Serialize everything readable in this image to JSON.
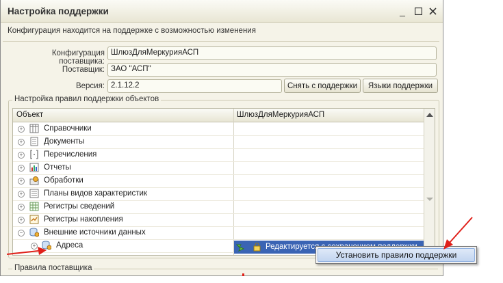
{
  "window": {
    "title": "Настройка поддержки",
    "subtitle": "Конфигурация находится на поддержке с возможностью изменения"
  },
  "form": {
    "vendor_config_label": "Конфигурация поставщика:",
    "vendor_config_value": "ШлюзДляМеркурияАСП",
    "vendor_label": "Поставщик:",
    "vendor_value": "ЗАО \"АСП\"",
    "version_label": "Версия:",
    "version_value": "2.1.12.2",
    "unsupport_button": "Снять с поддержки",
    "languages_button": "Языки поддержки"
  },
  "rules_group": {
    "label": "Настройка правил поддержки объектов",
    "columns": [
      "Объект",
      "ШлюзДляМеркурияАСП"
    ],
    "rows": [
      {
        "label": "Справочники",
        "icon": "catalog-icon",
        "expander": "+",
        "level": 0
      },
      {
        "label": "Документы",
        "icon": "document-icon",
        "expander": "+",
        "level": 0
      },
      {
        "label": "Перечисления",
        "icon": "enum-icon",
        "expander": "+",
        "level": 0
      },
      {
        "label": "Отчеты",
        "icon": "report-icon",
        "expander": "+",
        "level": 0
      },
      {
        "label": "Обработки",
        "icon": "processing-icon",
        "expander": "+",
        "level": 0
      },
      {
        "label": "Планы видов характеристик",
        "icon": "chart-types-icon",
        "expander": "+",
        "level": 0
      },
      {
        "label": "Регистры сведений",
        "icon": "info-register-icon",
        "expander": "+",
        "level": 0
      },
      {
        "label": "Регистры накопления",
        "icon": "accum-register-icon",
        "expander": "+",
        "level": 0
      },
      {
        "label": "Внешние источники данных",
        "icon": "external-sources-icon",
        "expander": "−",
        "level": 0
      },
      {
        "label": "Адреса",
        "icon": "external-source-item-icon",
        "expander": "+",
        "level": 1,
        "value": "Редактируется с сохранением поддержки"
      }
    ]
  },
  "context_menu": {
    "item": "Установить правило поддержки"
  },
  "vendor_rules_group": {
    "label": "Правила поставщика"
  },
  "colors": {
    "selection": "#3a64b4",
    "annotation_arrow": "#e0201a"
  }
}
